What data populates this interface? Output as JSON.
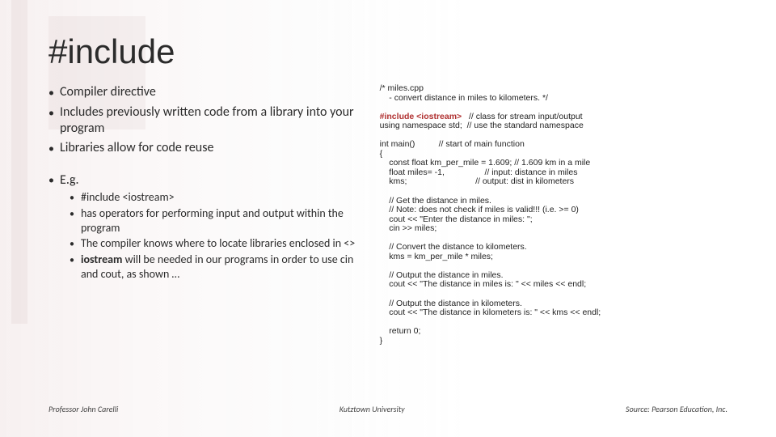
{
  "title": "#include",
  "left": {
    "bullets": [
      "Compiler directive",
      "Includes previously written code from a library into your program",
      "Libraries allow for code reuse"
    ],
    "eg_label": "E.g.",
    "eg": [
      {
        "text": "#include <iostream>"
      },
      {
        "text": "has operators for performing input and output within the program"
      },
      {
        "text": "The compiler knows where to locate libraries enclosed in <>"
      },
      {
        "pre": "iostream",
        "post": " will be needed in our programs in order to use cin and cout, as shown …"
      }
    ]
  },
  "code": {
    "l01": "/* miles.cpp",
    "l02": "    - convert distance in miles to kilometers. */",
    "l03": "",
    "l04a": "#include <iostream>",
    "l04b": "   // class for stream input/output",
    "l05": "using namespace std;  // use the standard namespace",
    "l06": "",
    "l07": "int main()          // start of main function",
    "l08": "{",
    "l09": "    const float km_per_mile = 1.609; // 1.609 km in a mile",
    "l10": "    float miles= -1,                 // input: distance in miles",
    "l11": "    kms;                             // output: dist in kilometers",
    "l12": "",
    "l13": "    // Get the distance in miles.",
    "l14": "    // Note: does not check if miles is valid!!! (i.e. >= 0)",
    "l15": "    cout << \"Enter the distance in miles: \";",
    "l16": "    cin >> miles;",
    "l17": "",
    "l18": "    // Convert the distance to kilometers.",
    "l19": "    kms = km_per_mile * miles;",
    "l20": "",
    "l21": "    // Output the distance in miles.",
    "l22": "    cout << \"The distance in miles is: \" << miles << endl;",
    "l23": "",
    "l24": "    // Output the distance in kilometers.",
    "l25": "    cout << \"The distance in kilometers is: \" << kms << endl;",
    "l26": "",
    "l27": "    return 0;",
    "l28": "}"
  },
  "footer": {
    "left": "Professor John Carelli",
    "center": "Kutztown University",
    "right": "Source: Pearson Education, Inc."
  }
}
